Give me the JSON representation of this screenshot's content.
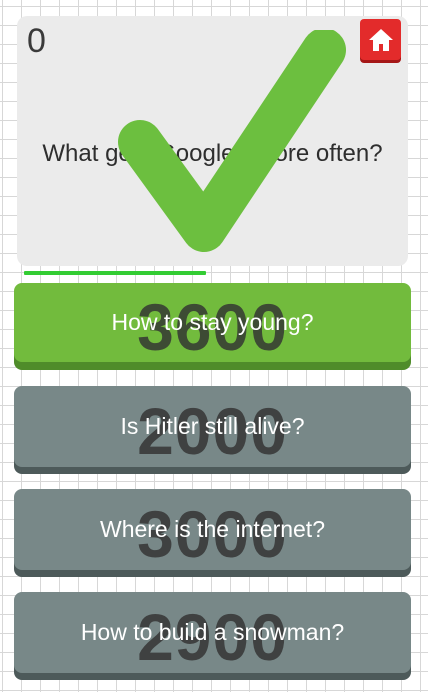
{
  "game": {
    "score": "0",
    "question": "What gets Googled more often?",
    "timer_fraction": 0.48
  },
  "answers": [
    {
      "label": "How to stay young?",
      "count": "3600",
      "state": "correct"
    },
    {
      "label": "Is Hitler still alive?",
      "count": "2000",
      "state": "neutral"
    },
    {
      "label": "Where is the internet?",
      "count": "3000",
      "state": "neutral"
    },
    {
      "label": "How to build a snowman?",
      "count": "2900",
      "state": "neutral"
    }
  ],
  "colors": {
    "correct": "#72bb3d",
    "neutral": "#788888",
    "home_button": "#e32b2b",
    "checkmark": "#6cbf3f",
    "timer": "#33cc33"
  },
  "icons": {
    "home": "home-icon",
    "result": "checkmark-icon"
  }
}
